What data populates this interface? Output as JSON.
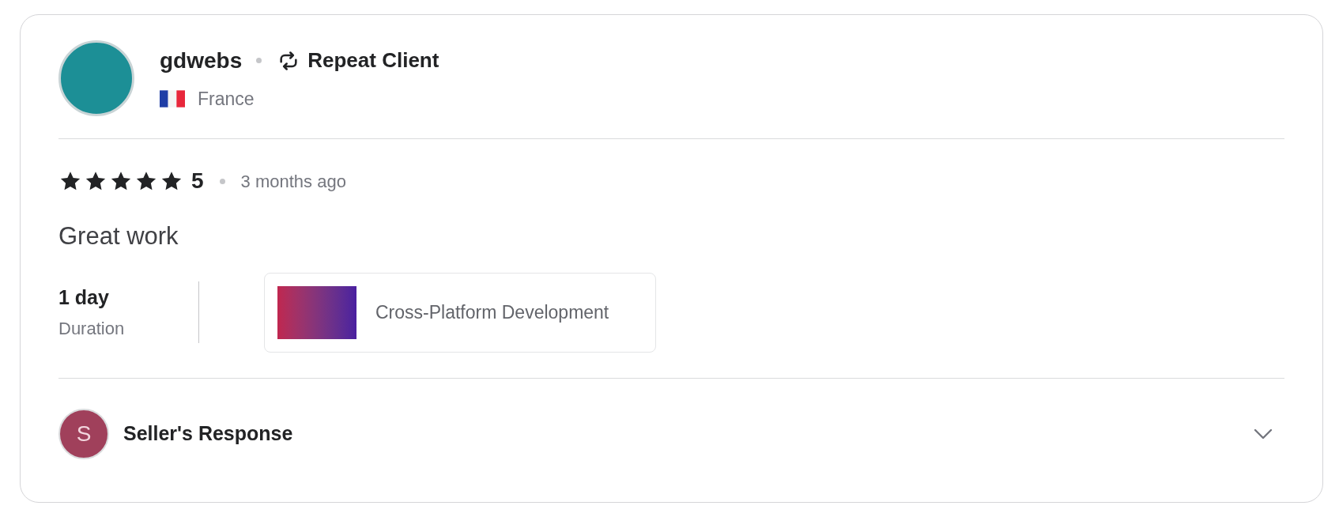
{
  "reviewer": {
    "name": "gdwebs",
    "badge": "Repeat Client",
    "country": "France"
  },
  "rating": {
    "stars": 5,
    "score": "5",
    "time": "3 months ago"
  },
  "comment": "Great work",
  "duration": {
    "value": "1 day",
    "label": "Duration"
  },
  "gig": {
    "title": "Cross-Platform Development"
  },
  "seller_response": {
    "initial": "S",
    "label": "Seller's Response",
    "expanded": false
  }
}
